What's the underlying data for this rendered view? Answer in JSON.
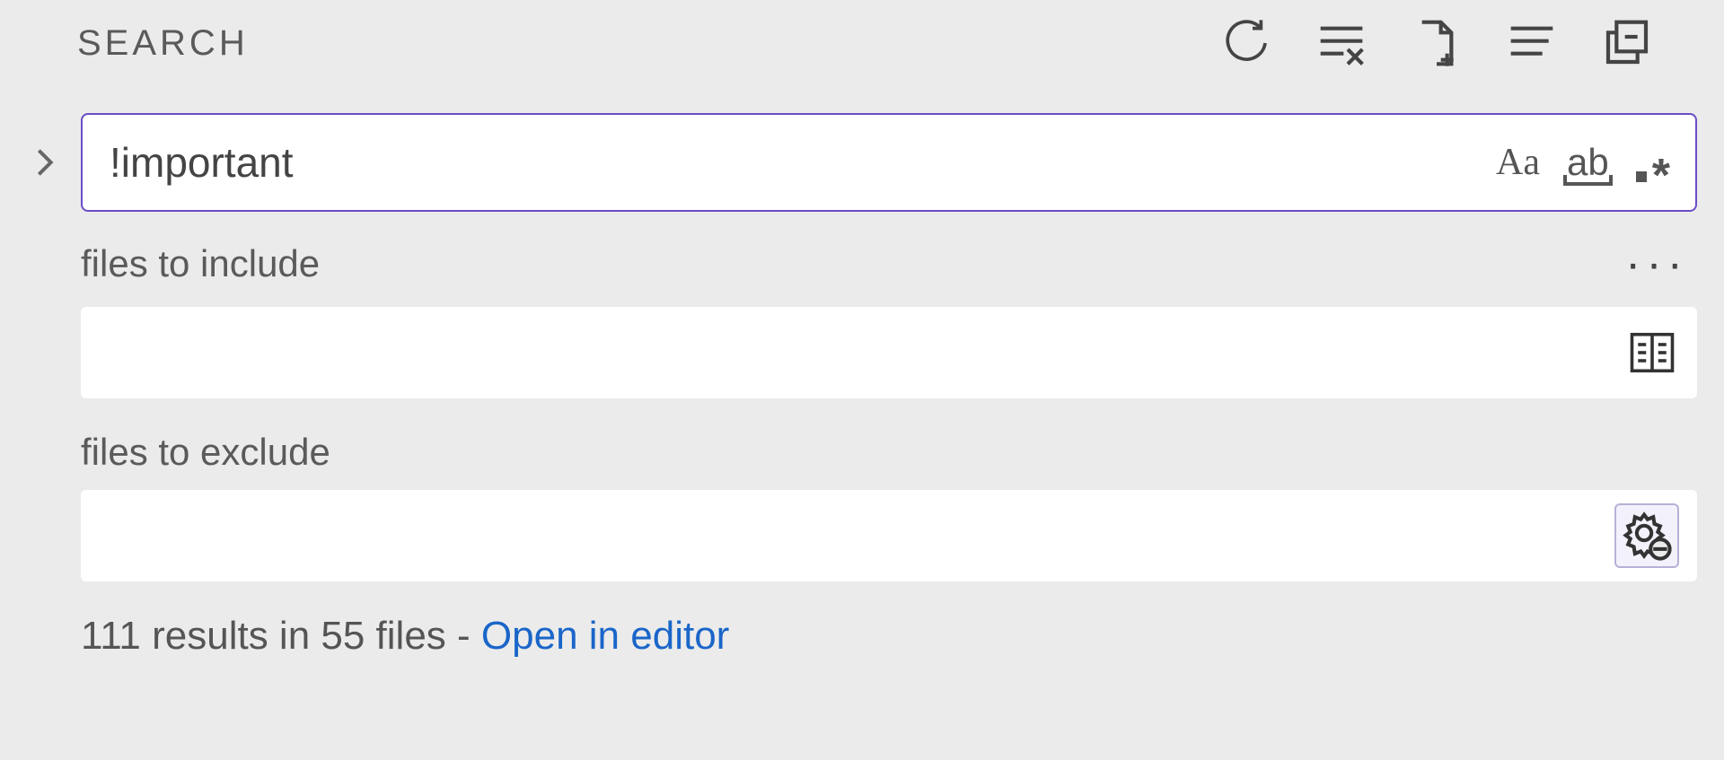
{
  "header": {
    "title": "SEARCH",
    "actions": {
      "refresh": "refresh",
      "clear": "clear-search-results",
      "new_editor": "open-new-search-editor",
      "view_tree": "view-as-tree",
      "collapse": "collapse-all"
    }
  },
  "search": {
    "query": "!important",
    "toggles": {
      "match_case": "Aa",
      "whole_word": "ab",
      "regex_dot": ".",
      "regex_ast": "*"
    }
  },
  "details": {
    "more": "···",
    "include_label": "files to include",
    "include_value": "",
    "exclude_label": "files to exclude",
    "exclude_value": ""
  },
  "summary": {
    "text": "111 results in 55 files - ",
    "link": "Open in editor"
  }
}
